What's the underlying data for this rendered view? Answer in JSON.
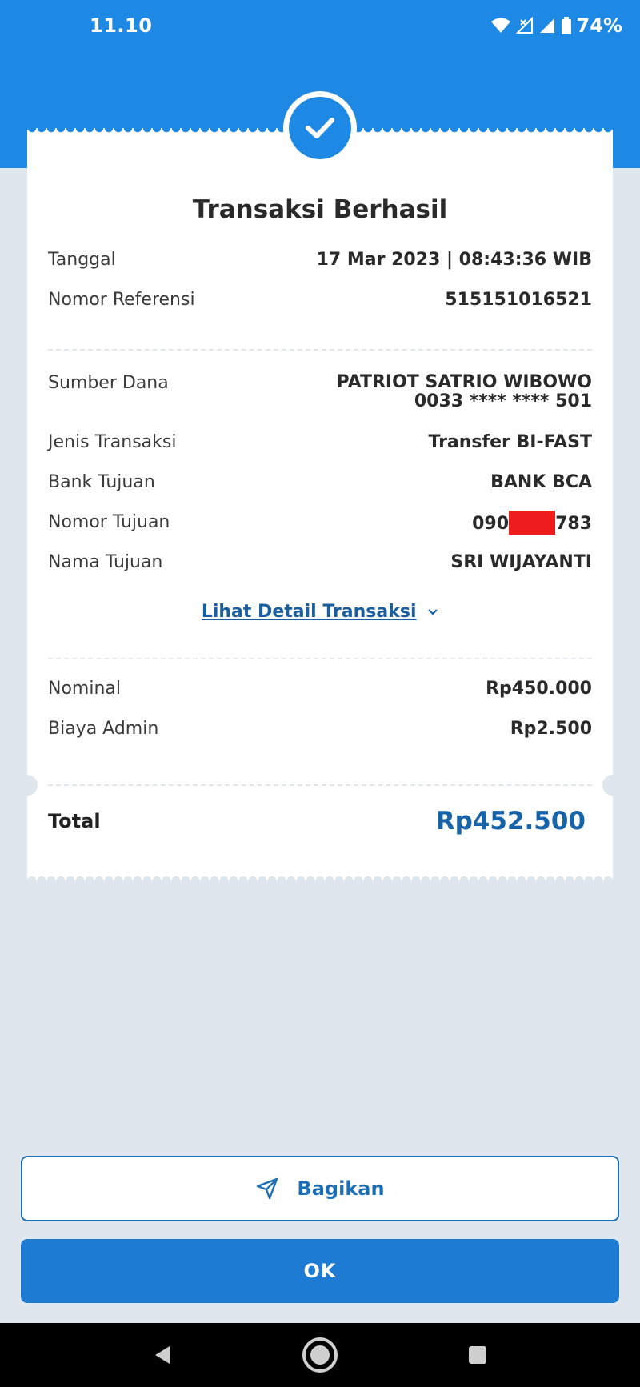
{
  "status_bar": {
    "time": "11.10",
    "battery": "74%"
  },
  "receipt": {
    "title": "Transaksi Berhasil",
    "rows_top": [
      {
        "label": "Tanggal",
        "value": "17 Mar 2023 | 08:43:36 WIB"
      },
      {
        "label": "Nomor Referensi",
        "value": "515151016521"
      }
    ],
    "sumber_dana": {
      "label": "Sumber Dana",
      "name": "PATRIOT SATRIO WIBOWO",
      "account": "0033 **** **** 501"
    },
    "rows_mid": [
      {
        "label": "Jenis Transaksi",
        "value": "Transfer BI-FAST"
      },
      {
        "label": "Bank Tujuan",
        "value": "BANK BCA"
      }
    ],
    "nomor_tujuan": {
      "label": "Nomor Tujuan",
      "prefix": "090",
      "suffix": "783"
    },
    "nama_tujuan": {
      "label": "Nama Tujuan",
      "value": "SRI WIJAYANTI"
    },
    "detail_link": "Lihat Detail Transaksi",
    "amounts": [
      {
        "label": "Nominal",
        "value": "Rp450.000"
      },
      {
        "label": "Biaya Admin",
        "value": "Rp2.500"
      }
    ],
    "total": {
      "label": "Total",
      "value": "Rp452.500"
    }
  },
  "actions": {
    "share_label": "Bagikan",
    "ok_label": "OK"
  },
  "colors": {
    "primary": "#1e88e5",
    "total_text": "#1763a8",
    "mask": "#ee1c1c"
  }
}
